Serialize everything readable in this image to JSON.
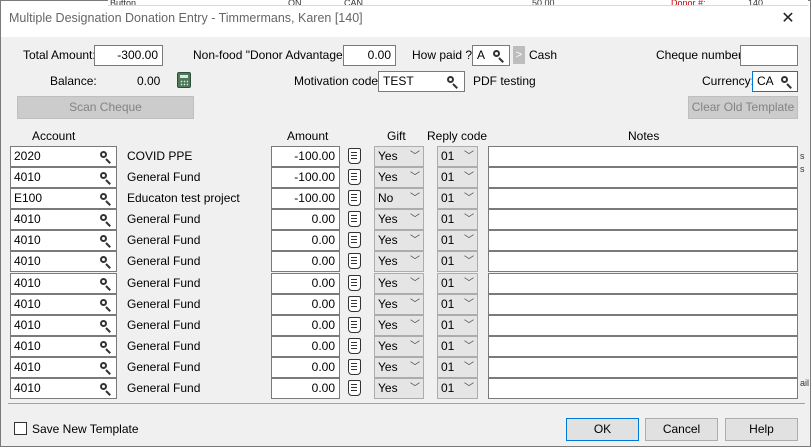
{
  "background_window": {
    "cells": [
      "Button",
      "ON",
      "CAN",
      "50.00",
      "Donor #:",
      "140"
    ]
  },
  "dialog": {
    "title": "Multiple Designation Donation Entry - Timmermans, Karen [140]",
    "close_glyph": "✕"
  },
  "header": {
    "total_amount_label": "Total Amount:",
    "total_amount_value": "-300.00",
    "nonfood_label": "Non-food \"Donor Advantage\":",
    "nonfood_value": "0.00",
    "how_paid_label": "How paid ?:",
    "how_paid_value": "A",
    "how_paid_arrow": ">",
    "how_paid_text": "Cash",
    "cheque_number_label": "Cheque number:",
    "cheque_number_value": "",
    "balance_label": "Balance:",
    "balance_value": "0.00",
    "motivation_label": "Motivation code:",
    "motivation_value": "TEST",
    "motivation_text": "PDF testing",
    "currency_label": "Currency:",
    "currency_value": "CA",
    "scan_cheque_label": "Scan Cheque",
    "clear_template_label": "Clear Old Template"
  },
  "columns": {
    "account": "Account",
    "amount": "Amount",
    "gift": "Gift",
    "reply_code": "Reply code",
    "notes": "Notes"
  },
  "rows": [
    {
      "account": "2020",
      "name": "COVID PPE",
      "amount": "-100.00",
      "gift": "Yes",
      "reply": "01",
      "notes": ""
    },
    {
      "account": "4010",
      "name": "General Fund",
      "amount": "-100.00",
      "gift": "Yes",
      "reply": "01",
      "notes": ""
    },
    {
      "account": "E100",
      "name": "Educaton test project",
      "amount": "-100.00",
      "gift": "No",
      "reply": "01",
      "notes": ""
    },
    {
      "account": "4010",
      "name": "General Fund",
      "amount": "0.00",
      "gift": "Yes",
      "reply": "01",
      "notes": ""
    },
    {
      "account": "4010",
      "name": "General Fund",
      "amount": "0.00",
      "gift": "Yes",
      "reply": "01",
      "notes": ""
    },
    {
      "account": "4010",
      "name": "General Fund",
      "amount": "0.00",
      "gift": "Yes",
      "reply": "01",
      "notes": ""
    },
    {
      "account": "4010",
      "name": "General Fund",
      "amount": "0.00",
      "gift": "Yes",
      "reply": "01",
      "notes": ""
    },
    {
      "account": "4010",
      "name": "General Fund",
      "amount": "0.00",
      "gift": "Yes",
      "reply": "01",
      "notes": ""
    },
    {
      "account": "4010",
      "name": "General Fund",
      "amount": "0.00",
      "gift": "Yes",
      "reply": "01",
      "notes": ""
    },
    {
      "account": "4010",
      "name": "General Fund",
      "amount": "0.00",
      "gift": "Yes",
      "reply": "01",
      "notes": ""
    },
    {
      "account": "4010",
      "name": "General Fund",
      "amount": "0.00",
      "gift": "Yes",
      "reply": "01",
      "notes": ""
    },
    {
      "account": "4010",
      "name": "General Fund",
      "amount": "0.00",
      "gift": "Yes",
      "reply": "01",
      "notes": ""
    }
  ],
  "right_edge_fragments": [
    "s",
    "s",
    "ail"
  ],
  "footer": {
    "save_template_label": "Save New Template",
    "save_template_checked": false,
    "ok_label": "OK",
    "cancel_label": "Cancel",
    "help_label": "Help"
  },
  "icons": {
    "lookup": "magnifier-icon",
    "calculator": "calculator-icon",
    "note": "note-icon",
    "dropdown": "chevron-down-icon"
  },
  "colors": {
    "dialog_bg": "#f0f0f0",
    "focus_border": "#0078d7"
  }
}
